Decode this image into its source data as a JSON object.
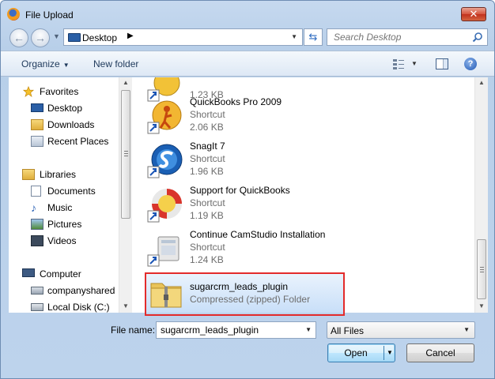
{
  "window": {
    "title": "File Upload",
    "close_label": "✕"
  },
  "address": {
    "location": "Desktop",
    "search_placeholder": "Search Desktop"
  },
  "toolbar": {
    "organize_label": "Organize",
    "new_folder_label": "New folder"
  },
  "nav": {
    "favorites_label": "Favorites",
    "favorites": [
      {
        "label": "Desktop",
        "icon": "desktop-icon"
      },
      {
        "label": "Downloads",
        "icon": "downloads-folder-icon"
      },
      {
        "label": "Recent Places",
        "icon": "recent-places-icon"
      }
    ],
    "libraries_label": "Libraries",
    "libraries": [
      {
        "label": "Documents",
        "icon": "documents-icon"
      },
      {
        "label": "Music",
        "icon": "music-icon"
      },
      {
        "label": "Pictures",
        "icon": "pictures-icon"
      },
      {
        "label": "Videos",
        "icon": "videos-icon"
      }
    ],
    "computer_label": "Computer",
    "computer": [
      {
        "label": "companyshared",
        "icon": "network-drive-icon"
      },
      {
        "label": "Local Disk (C:)",
        "icon": "local-disk-icon"
      }
    ]
  },
  "files": [
    {
      "name": "",
      "type": "",
      "size": "1.23 KB",
      "icon": "app-shortcut-icon"
    },
    {
      "name": "QuickBooks Pro 2009",
      "type": "Shortcut",
      "size": "2.06 KB",
      "icon": "quickbooks-icon"
    },
    {
      "name": "SnagIt 7",
      "type": "Shortcut",
      "size": "1.96 KB",
      "icon": "snagit-icon"
    },
    {
      "name": "Support for QuickBooks",
      "type": "Shortcut",
      "size": "1.19 KB",
      "icon": "lifebuoy-icon"
    },
    {
      "name": "Continue CamStudio Installation",
      "type": "Shortcut",
      "size": "1.24 KB",
      "icon": "installer-icon"
    },
    {
      "name": "sugarcrm_leads_plugin",
      "type": "Compressed (zipped) Folder",
      "size": "",
      "icon": "zip-folder-icon"
    }
  ],
  "bottom": {
    "file_name_label": "File name:",
    "file_name_value": "sugarcrm_leads_plugin",
    "filter_value": "All Files",
    "open_label": "Open",
    "cancel_label": "Cancel"
  },
  "colors": {
    "selection_highlight": "#e32b2b",
    "window_chrome": "#bdd3ec"
  }
}
